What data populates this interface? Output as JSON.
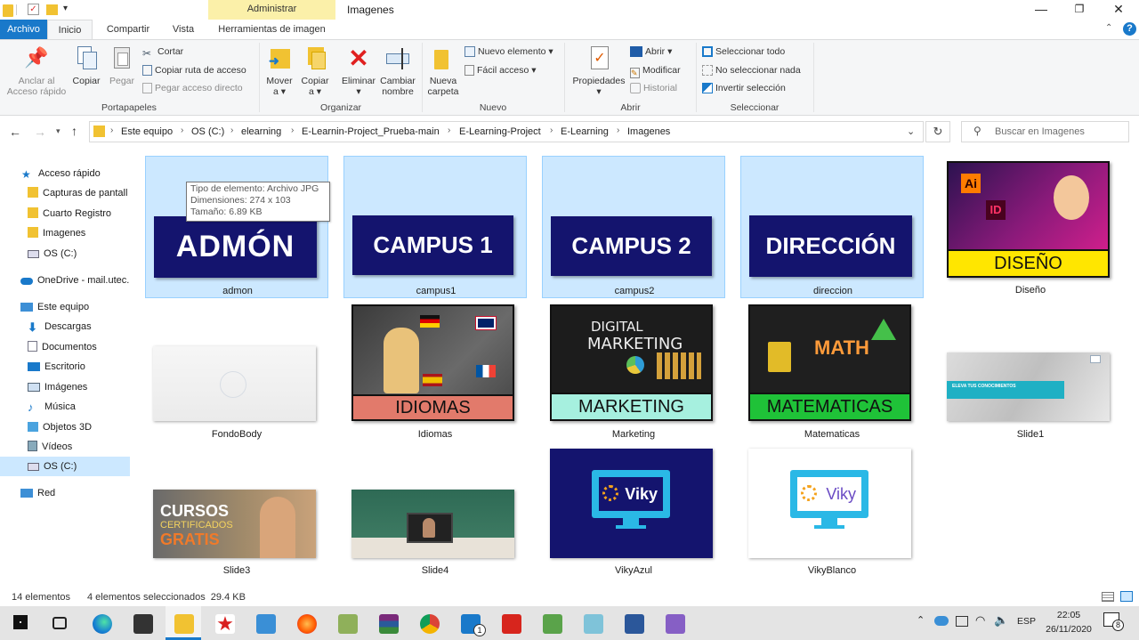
{
  "title_bar": {
    "context_tab": "Administrar",
    "window_title": "Imagenes",
    "minimize": "—",
    "maximize": "❐",
    "close": "✕"
  },
  "tabs": [
    "Archivo",
    "Inicio",
    "Compartir",
    "Vista",
    "Herramientas de imagen"
  ],
  "ribbon": {
    "portapapeles": {
      "label": "Portapapeles",
      "anclar": [
        "Anclar al",
        "Acceso rápido"
      ],
      "copiar": "Copiar",
      "pegar": "Pegar",
      "cortar": "Cortar",
      "copiar_ruta": "Copiar ruta de acceso",
      "pegar_acceso": "Pegar acceso directo"
    },
    "organizar": {
      "label": "Organizar",
      "mover": [
        "Mover",
        "a ▾"
      ],
      "copiar_a": [
        "Copiar",
        "a ▾"
      ],
      "eliminar": [
        "Eliminar",
        "▾"
      ],
      "cambiar": [
        "Cambiar",
        "nombre"
      ]
    },
    "nuevo": {
      "label": "Nuevo",
      "carpeta": [
        "Nueva",
        "carpeta"
      ],
      "nuevo_elemento": "Nuevo elemento ▾",
      "facil_acceso": "Fácil acceso ▾"
    },
    "abrir": {
      "label": "Abrir",
      "propiedades": [
        "Propiedades",
        "▾"
      ],
      "abrir": "Abrir ▾",
      "modificar": "Modificar",
      "historial": "Historial"
    },
    "seleccionar": {
      "label": "Seleccionar",
      "todo": "Seleccionar todo",
      "nada": "No seleccionar nada",
      "invertir": "Invertir selección"
    }
  },
  "address": {
    "crumbs": [
      "Este equipo",
      "OS (C:)",
      "elearning",
      "E-Learnin-Project_Prueba-main",
      "E-Learning-Project",
      "E-Learning",
      "Imagenes"
    ],
    "search_placeholder": "Buscar en Imagenes"
  },
  "nav": [
    {
      "label": "Acceso rápido",
      "icon": "star-icon"
    },
    {
      "label": "Capturas de pantall",
      "icon": "folder-icon"
    },
    {
      "label": "Cuarto Registro",
      "icon": "folder-icon"
    },
    {
      "label": "Imagenes",
      "icon": "folder-icon"
    },
    {
      "label": "OS (C:)",
      "icon": "drive-icon"
    },
    {
      "label": "OneDrive - mail.utec.",
      "icon": "cloud-icon"
    },
    {
      "label": "Este equipo",
      "icon": "computer-icon"
    },
    {
      "label": "Descargas",
      "icon": "download-icon"
    },
    {
      "label": "Documentos",
      "icon": "document-icon"
    },
    {
      "label": "Escritorio",
      "icon": "desktop-icon"
    },
    {
      "label": "Imágenes",
      "icon": "pictures-icon"
    },
    {
      "label": "Música",
      "icon": "music-icon"
    },
    {
      "label": "Objetos 3D",
      "icon": "cube-icon"
    },
    {
      "label": "Vídeos",
      "icon": "video-icon"
    },
    {
      "label": "OS (C:)",
      "icon": "drive-icon"
    },
    {
      "label": "Red",
      "icon": "network-icon"
    }
  ],
  "files": [
    {
      "name": "admon",
      "banner": "ADMÓN"
    },
    {
      "name": "campus1",
      "banner": "CAMPUS 1"
    },
    {
      "name": "campus2",
      "banner": "CAMPUS 2"
    },
    {
      "name": "direccion",
      "banner": "DIRECCIÓN"
    },
    {
      "name": "Diseño",
      "banner": "DISEÑO"
    },
    {
      "name": "FondoBody"
    },
    {
      "name": "Idiomas",
      "banner": "IDIOMAS"
    },
    {
      "name": "Marketing",
      "banner": "MARKETING",
      "extra": "DIGITAL"
    },
    {
      "name": "Matematicas",
      "banner": "MATEMATICAS",
      "extra": "MATH"
    },
    {
      "name": "Slide1",
      "banner": "ELEVA TUS CONOCIMIENTOS"
    },
    {
      "name": "Slide3",
      "banner": "CURSOS",
      "sub1": "CERTIFICADOS",
      "sub2": "GRATIS"
    },
    {
      "name": "Slide4"
    },
    {
      "name": "VikyAzul",
      "banner": "Viky"
    },
    {
      "name": "VikyBlanco",
      "banner": "Viky"
    }
  ],
  "tooltip": [
    "Tipo de elemento: Archivo JPG",
    "Dimensiones: 274 x 103",
    "Tamaño: 6.89 KB"
  ],
  "status": {
    "count": "14 elementos",
    "selected": "4 elementos seleccionados  29.4 KB"
  },
  "taskbar": {
    "lang": "ESP",
    "time": "22:05",
    "date": "26/11/2020",
    "mail_badge": "1",
    "notif_badge": "8"
  },
  "colors": {
    "accent": "#1979ca",
    "selection": "#cce8ff",
    "navy": "#14146e",
    "context_tab": "#fbf0a9"
  }
}
